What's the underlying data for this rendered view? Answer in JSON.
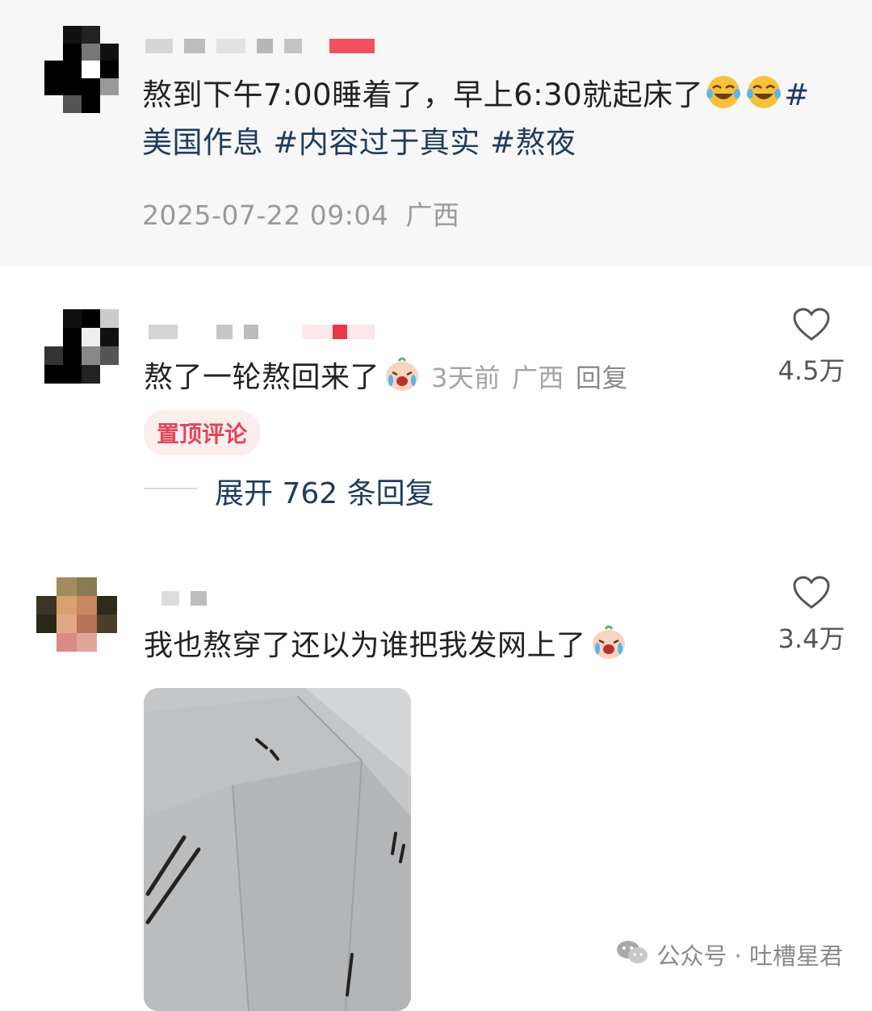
{
  "post": {
    "text_parts": {
      "line1": "熬到下午7:00睡着了，早上6:30就起床了",
      "hash_start": "#",
      "line2_tag1": "美国作息",
      "line2_tag2": "#内容过于真实",
      "line2_tag3": "#熬夜"
    },
    "timestamp": "2025-07-22 09:04",
    "location": "广西"
  },
  "comments": [
    {
      "text": "熬了一轮熬回来了",
      "emoji": "crying-face-emoji",
      "time": "3天前",
      "location": "广西",
      "reply_label": "回复",
      "likes": "4.5万",
      "pinned_label": "置顶评论",
      "expand_label": "展开 762 条回复"
    },
    {
      "text": "我也熬穿了还以为谁把我发网上了",
      "emoji": "crying-face-emoji",
      "likes": "3.4万"
    }
  ],
  "watermark": {
    "text": "公众号 · 吐槽星君",
    "icon": "wechat-icon"
  },
  "colors": {
    "hashtag": "#1f3b5e",
    "pinned_text": "#e0465a",
    "pinned_bg": "#fdeeee",
    "meta": "#9a9a9a"
  }
}
